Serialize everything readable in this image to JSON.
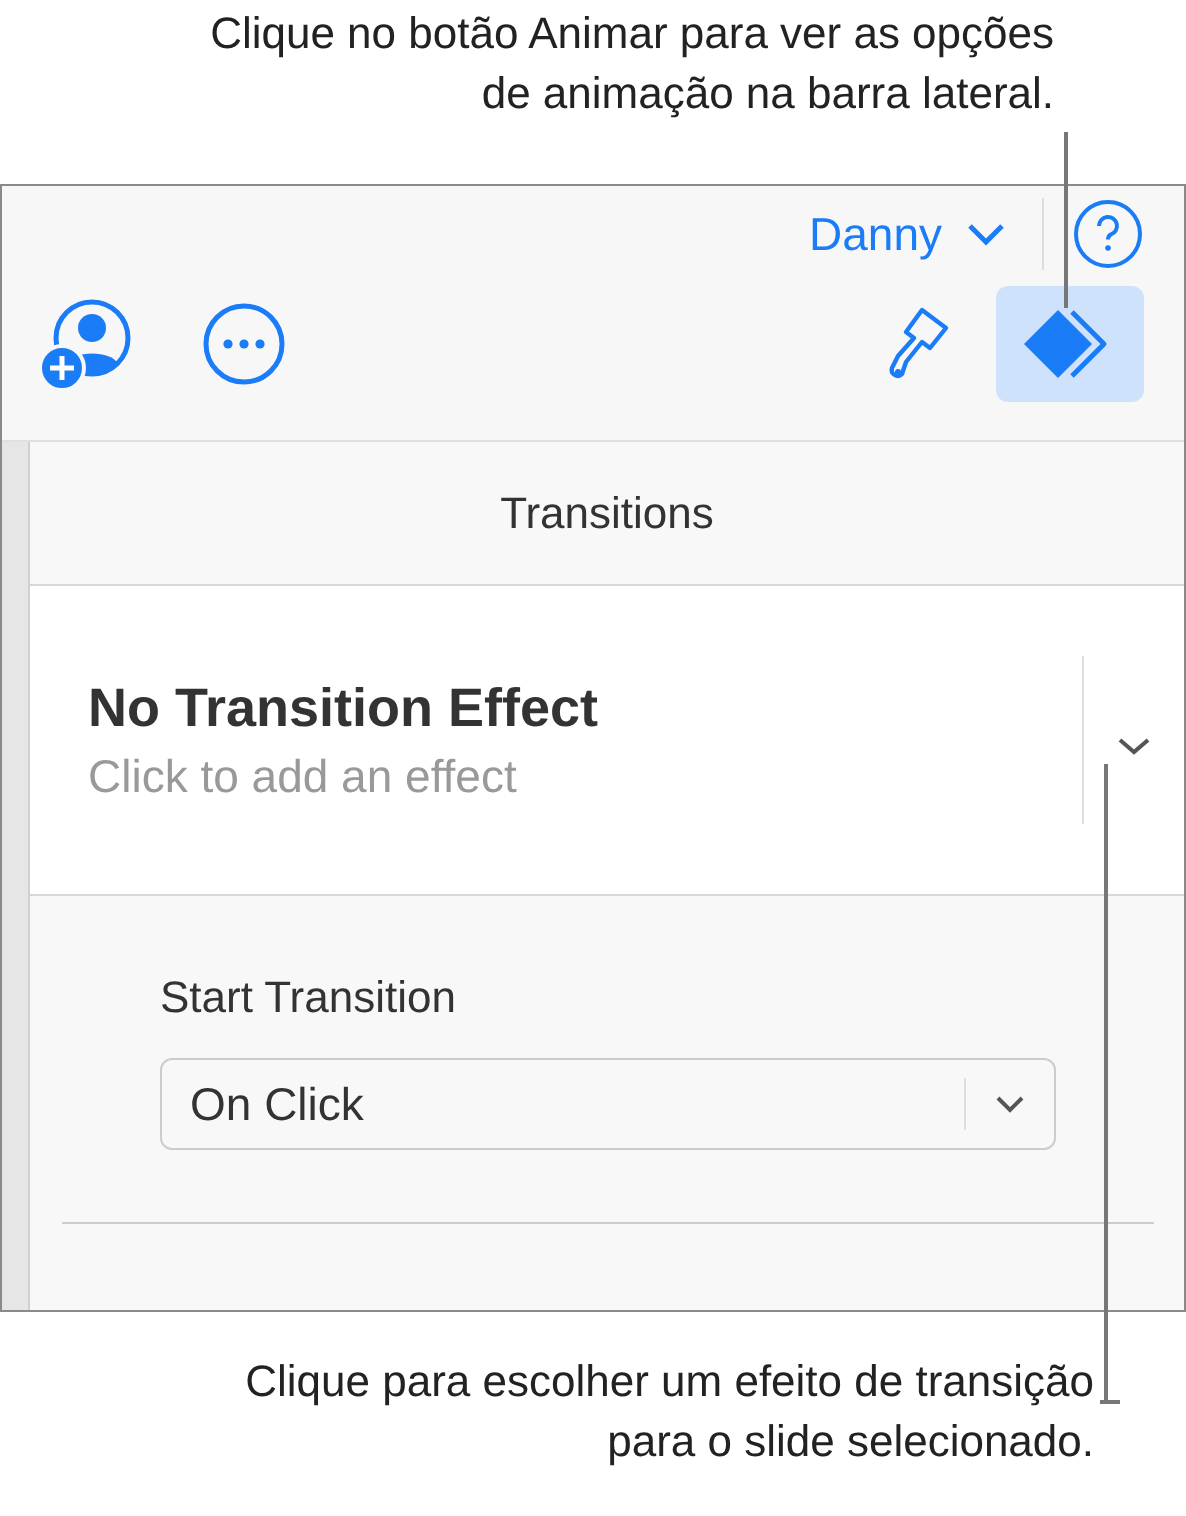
{
  "callouts": [
    {
      "text": "Clique no botão Animar para ver as opções de animação na barra lateral."
    },
    {
      "text": "Clique para escolher um efeito de transição para o slide selecionado."
    }
  ],
  "account": {
    "name": "Danny"
  },
  "toolbar": [
    {
      "kind": "collaborate",
      "selected": false
    },
    {
      "kind": "more",
      "selected": false
    },
    {
      "kind": "format",
      "selected": false
    },
    {
      "kind": "animate",
      "selected": true
    }
  ],
  "sidebar": {
    "title": "Transitions",
    "effect": {
      "title": "No Transition Effect",
      "subtitle": "Click to add an effect"
    },
    "start": {
      "label": "Start Transition",
      "value": "On Click"
    }
  }
}
